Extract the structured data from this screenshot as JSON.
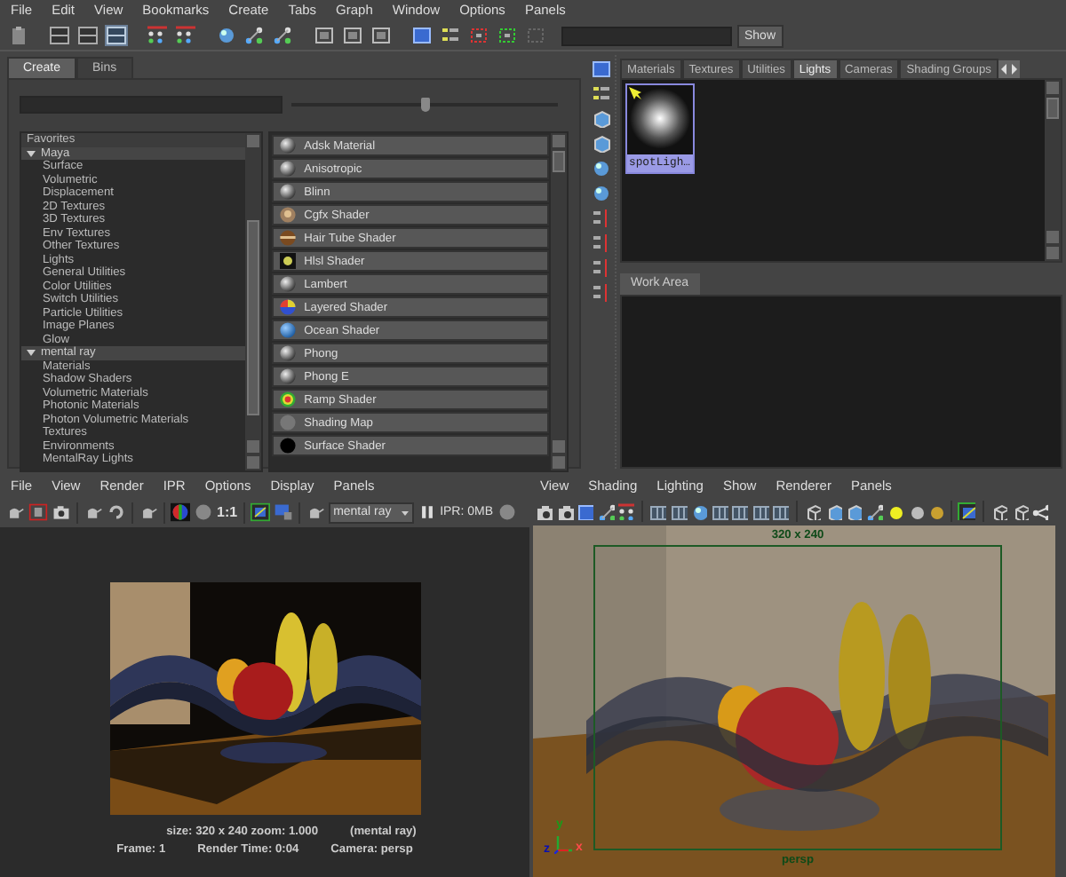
{
  "hypershade": {
    "menu": [
      "File",
      "Edit",
      "View",
      "Bookmarks",
      "Create",
      "Tabs",
      "Graph",
      "Window",
      "Options",
      "Panels"
    ],
    "toolbar": {
      "show_button": "Show"
    },
    "create_tabs": [
      {
        "label": "Create",
        "selected": true
      },
      {
        "label": "Bins",
        "selected": false
      }
    ],
    "zoom_slider": {
      "level": 0.5
    },
    "tree": [
      {
        "label": "Favorites",
        "kind": "header"
      },
      {
        "label": "Maya",
        "kind": "group",
        "expanded": true,
        "children": [
          {
            "label": "Surface"
          },
          {
            "label": "Volumetric"
          },
          {
            "label": "Displacement"
          },
          {
            "label": "2D Textures"
          },
          {
            "label": "3D Textures"
          },
          {
            "label": "Env Textures"
          },
          {
            "label": "Other Textures"
          },
          {
            "label": "Lights"
          },
          {
            "label": "General Utilities"
          },
          {
            "label": "Color Utilities"
          },
          {
            "label": "Switch Utilities"
          },
          {
            "label": "Particle Utilities"
          },
          {
            "label": "Image Planes"
          },
          {
            "label": "Glow"
          }
        ]
      },
      {
        "label": "mental ray",
        "kind": "group",
        "expanded": true,
        "children": [
          {
            "label": "Materials"
          },
          {
            "label": "Shadow Shaders"
          },
          {
            "label": "Volumetric Materials"
          },
          {
            "label": "Photonic Materials"
          },
          {
            "label": "Photon Volumetric Materials"
          },
          {
            "label": "Textures"
          },
          {
            "label": "Environments"
          },
          {
            "label": "MentalRay Lights"
          }
        ]
      }
    ],
    "nodes": [
      {
        "label": "Adsk Material",
        "kind": "gray"
      },
      {
        "label": "Anisotropic",
        "kind": "gray"
      },
      {
        "label": "Blinn",
        "kind": "gray"
      },
      {
        "label": "Cgfx Shader",
        "kind": "cgfx"
      },
      {
        "label": "Hair Tube Shader",
        "kind": "hair"
      },
      {
        "label": "Hlsl Shader",
        "kind": "hlsl"
      },
      {
        "label": "Lambert",
        "kind": "gray"
      },
      {
        "label": "Layered Shader",
        "kind": "layered"
      },
      {
        "label": "Ocean Shader",
        "kind": "ocean"
      },
      {
        "label": "Phong",
        "kind": "gray"
      },
      {
        "label": "Phong E",
        "kind": "gray"
      },
      {
        "label": "Ramp Shader",
        "kind": "ramp"
      },
      {
        "label": "Shading Map",
        "kind": "flat"
      },
      {
        "label": "Surface Shader",
        "kind": "black"
      }
    ],
    "browser_tabs": [
      {
        "label": "Materials",
        "selected": false
      },
      {
        "label": "Textures",
        "selected": false
      },
      {
        "label": "Utilities",
        "selected": false
      },
      {
        "label": "Lights",
        "selected": true
      },
      {
        "label": "Cameras",
        "selected": false
      },
      {
        "label": "Shading Groups",
        "selected": false
      }
    ],
    "swatches": [
      {
        "label": "spotLigh…",
        "selected": true
      }
    ],
    "work_area_tab": "Work Area"
  },
  "render_view": {
    "menu": [
      "File",
      "View",
      "Render",
      "IPR",
      "Options",
      "Display",
      "Panels"
    ],
    "zoom_label": "1:1",
    "renderer": "mental ray",
    "ipr_memory": "IPR: 0MB",
    "info_lines": [
      [
        "size: 320 x 240 zoom: 1.000",
        "(mental ray)"
      ],
      [
        "Frame: 1",
        "Render Time: 0:04",
        "Camera: persp"
      ]
    ]
  },
  "viewport": {
    "menu": [
      "View",
      "Shading",
      "Lighting",
      "Show",
      "Renderer",
      "Panels"
    ],
    "resolution": "320 x 240",
    "camera": "persp",
    "axes": [
      "y",
      "z",
      "x"
    ]
  }
}
